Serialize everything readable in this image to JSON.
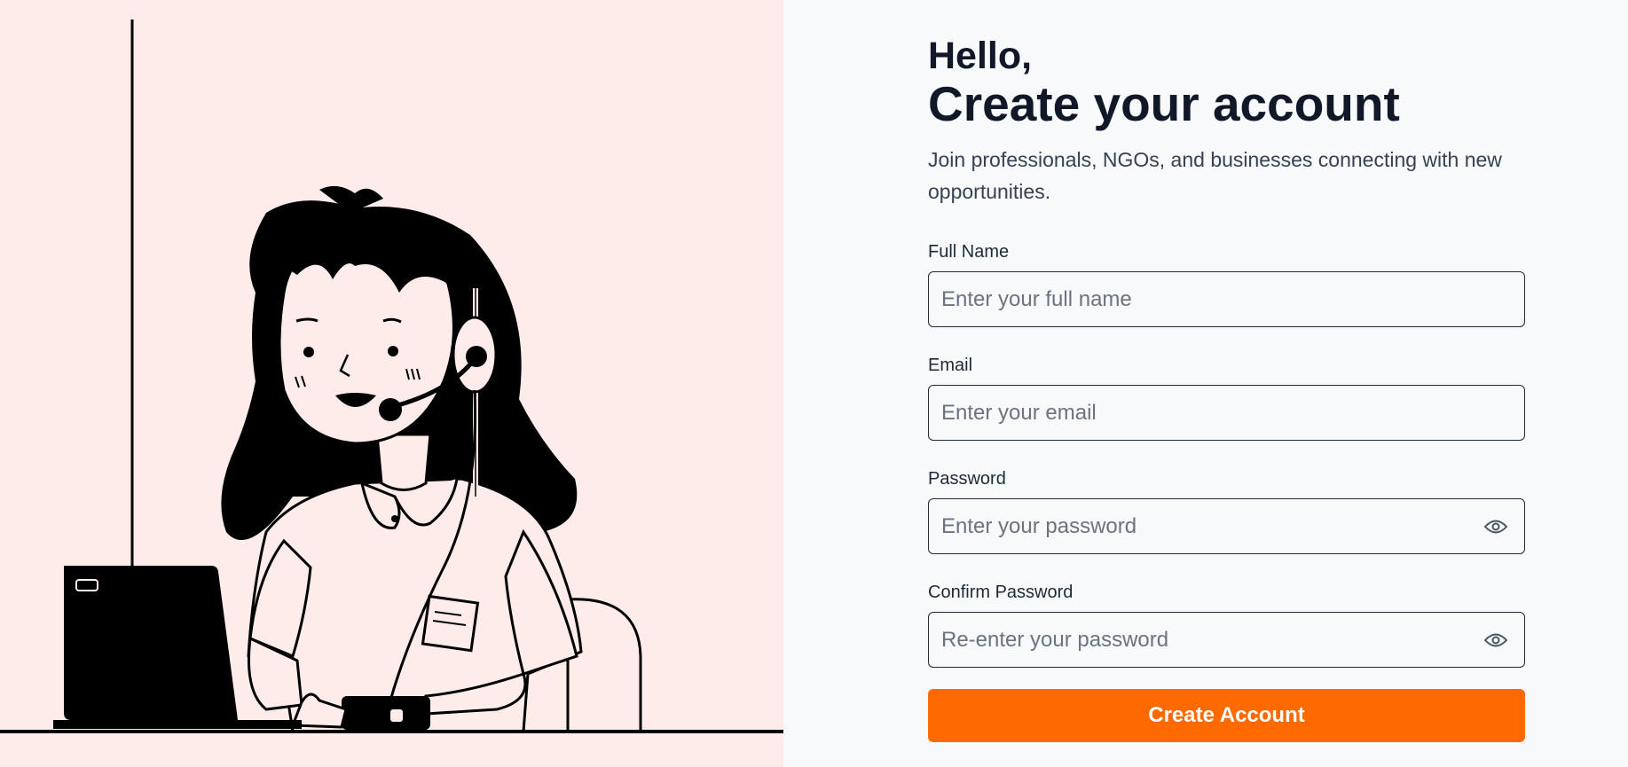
{
  "header": {
    "greeting": "Hello,",
    "title": "Create your account",
    "subtitle": "Join professionals, NGOs, and businesses connecting with new opportunities."
  },
  "form": {
    "full_name": {
      "label": "Full Name",
      "placeholder": "Enter your full name",
      "value": ""
    },
    "email": {
      "label": "Email",
      "placeholder": "Enter your email",
      "value": ""
    },
    "password": {
      "label": "Password",
      "placeholder": "Enter your password",
      "value": "",
      "icon": "eye-icon"
    },
    "confirm_password": {
      "label": "Confirm Password",
      "placeholder": "Re-enter your password",
      "value": "",
      "icon": "eye-icon"
    },
    "submit_label": "Create Account"
  },
  "illustration": {
    "subject": "support-agent-with-headset-at-laptop"
  },
  "colors": {
    "accent": "#ff6a00",
    "left_panel_bg": "#fdecea",
    "right_panel_bg": "#f8f9fb",
    "text_dark": "#111827"
  }
}
